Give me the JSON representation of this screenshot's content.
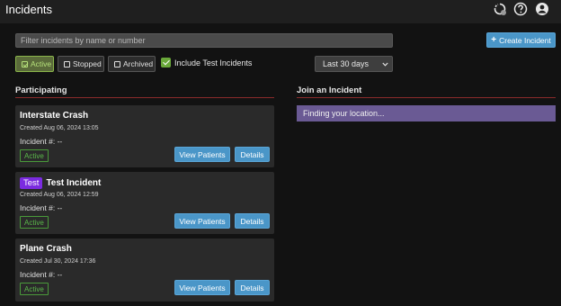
{
  "header": {
    "title": "Incidents",
    "icons": [
      "sync-status-icon",
      "help-icon",
      "account-icon"
    ]
  },
  "filter": {
    "placeholder": "Filter incidents by name or number"
  },
  "create_button": {
    "icon": "plus-icon",
    "label": "Create Incident"
  },
  "status_filters": [
    {
      "label": "Active",
      "checked": true
    },
    {
      "label": "Stopped",
      "checked": false
    },
    {
      "label": "Archived",
      "checked": false
    }
  ],
  "include_test": {
    "label": "Include Test Incidents",
    "checked": true
  },
  "date_range": {
    "selected": "Last 30 days"
  },
  "participating": {
    "title": "Participating",
    "incidents": [
      {
        "name": "Interstate Crash",
        "test_badge": "",
        "created": "Created Aug 06, 2024 13:05",
        "number": "Incident #: --",
        "status": "Active",
        "view_label": "View Patients",
        "details_label": "Details"
      },
      {
        "name": "Test Incident",
        "test_badge": "Test",
        "created": "Created Aug 06, 2024 12:59",
        "number": "Incident #: --",
        "status": "Active",
        "view_label": "View Patients",
        "details_label": "Details"
      },
      {
        "name": "Plane Crash",
        "test_badge": "",
        "created": "Created Jul 30, 2024 17:36",
        "number": "Incident #: --",
        "status": "Active",
        "view_label": "View Patients",
        "details_label": "Details"
      }
    ]
  },
  "join": {
    "title": "Join an Incident",
    "location_status": "Finding your location..."
  },
  "colors": {
    "accent": "#4a96c8",
    "active_green": "#5ab84a",
    "test_purple": "#7b2be0",
    "divider_red": "#8a2a2a",
    "location_purple": "#6a5a94"
  }
}
